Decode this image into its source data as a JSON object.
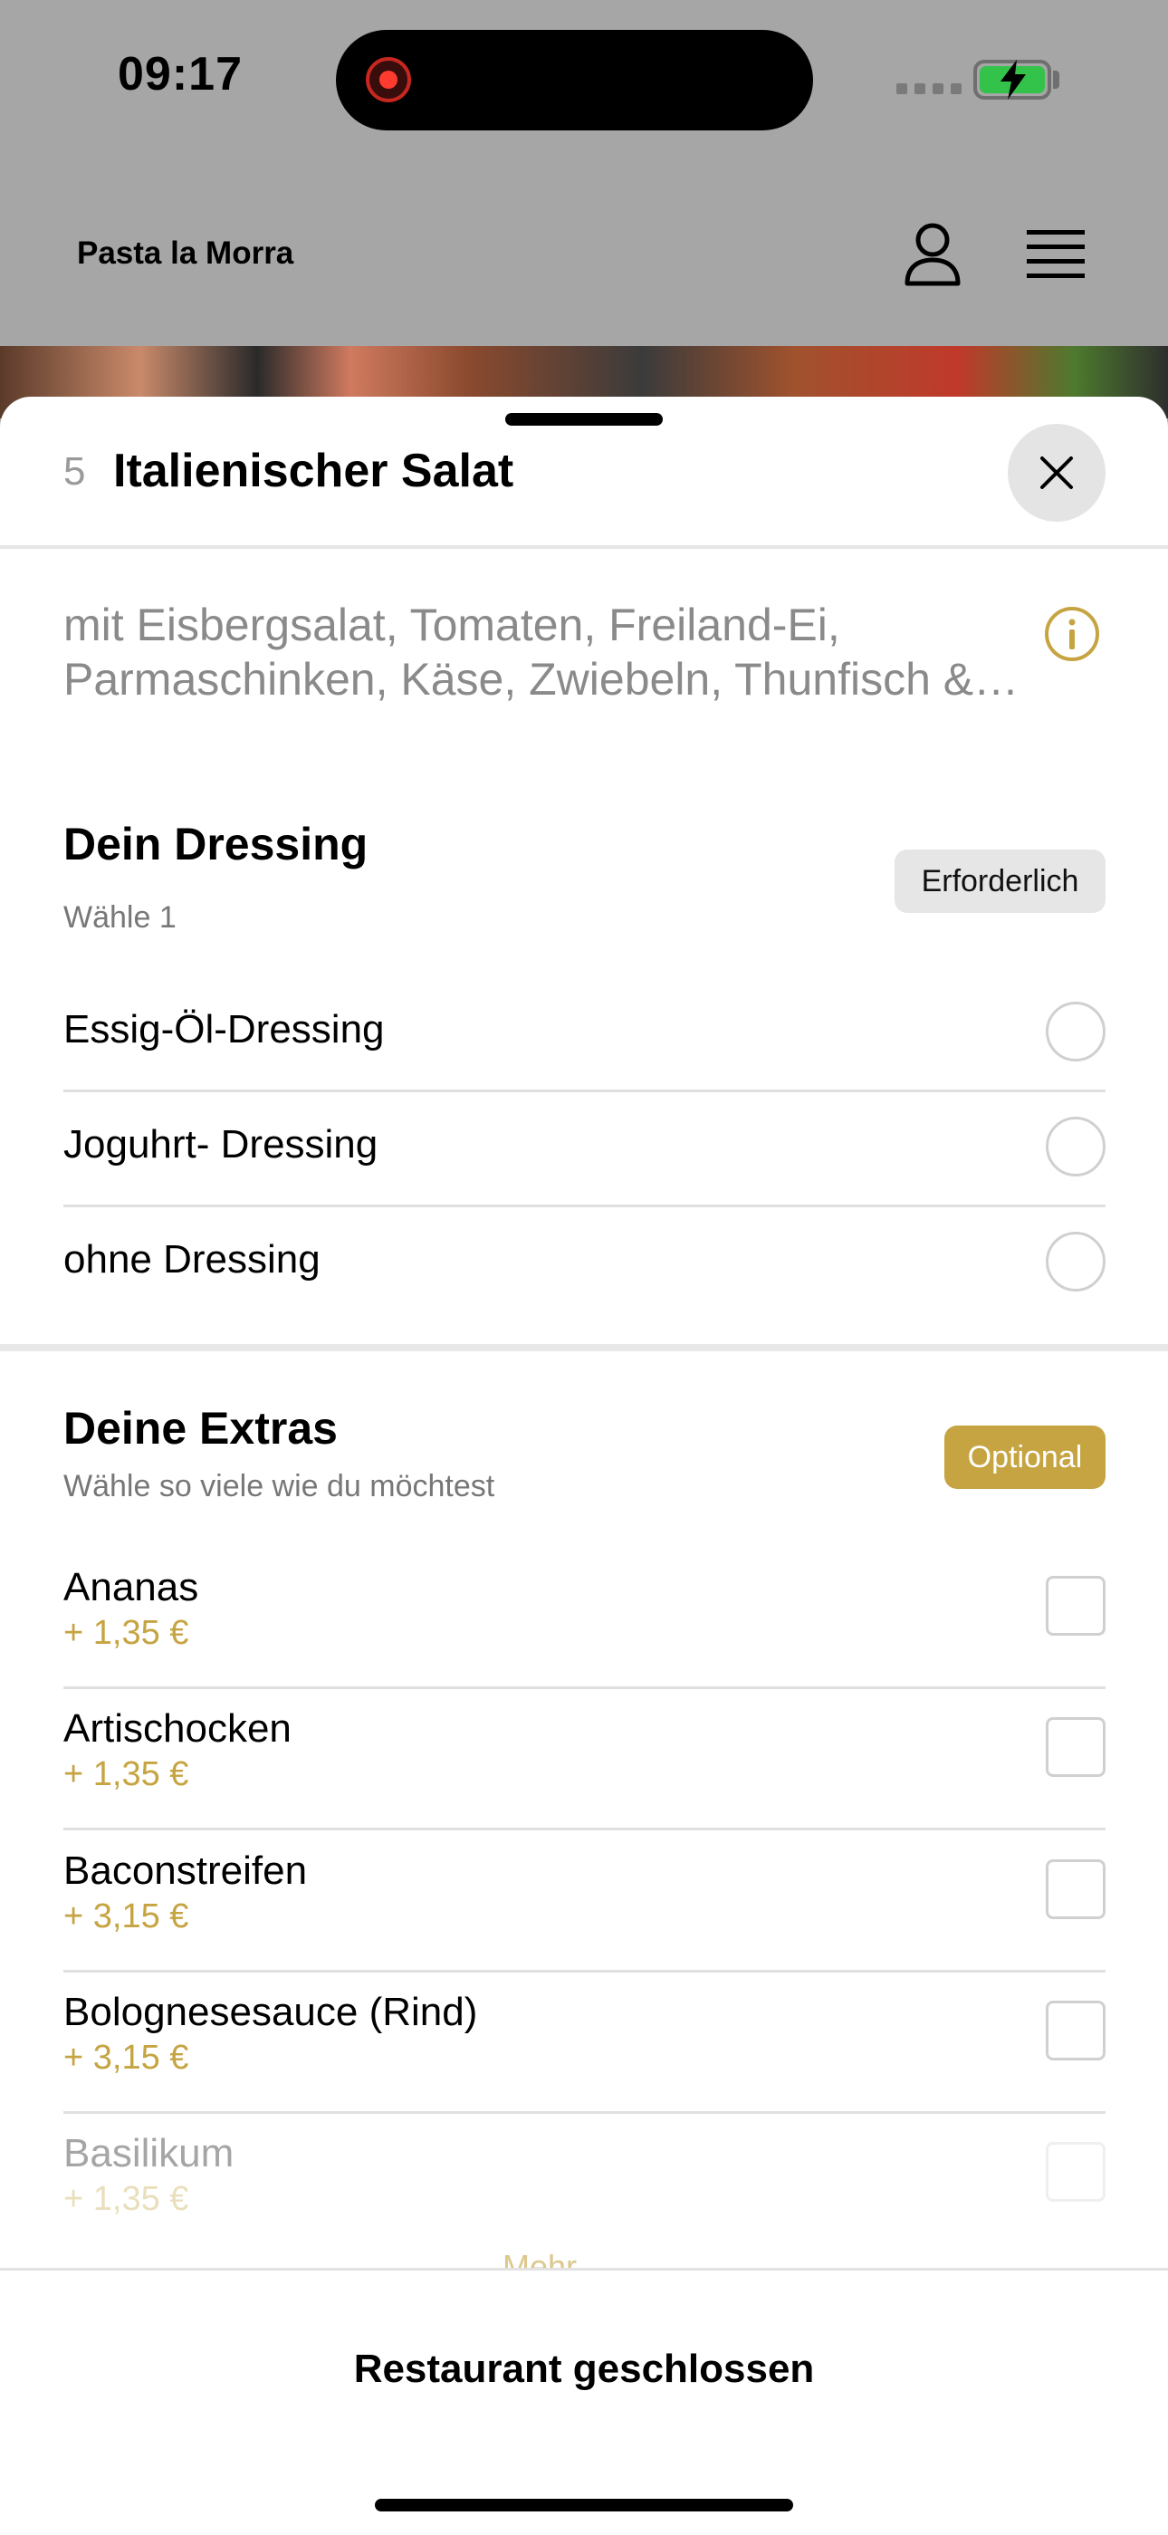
{
  "status_bar": {
    "time": "09:17"
  },
  "header": {
    "brand": "Pasta la Morra"
  },
  "item": {
    "number": "5",
    "title": "Italienischer Salat",
    "description": "mit Eisbergsalat, Tomaten, Freiland-Ei, Parmaschinken, Käse, Zwiebeln, Thunfisch & Oliven"
  },
  "dressing": {
    "title": "Dein Dressing",
    "subtitle": "Wähle 1",
    "badge": "Erforderlich",
    "options": [
      "Essig-Öl-Dressing",
      "Joguhrt- Dressing",
      "ohne Dressing"
    ]
  },
  "extras": {
    "title": "Deine Extras",
    "subtitle": "Wähle so viele wie du möchtest",
    "badge": "Optional",
    "items": [
      {
        "name": "Ananas",
        "price": "+ 1,35 €"
      },
      {
        "name": "Artischocken",
        "price": "+ 1,35 €"
      },
      {
        "name": "Baconstreifen",
        "price": "+ 3,15 €"
      },
      {
        "name": "Bolognesesauce (Rind)",
        "price": "+ 3,15 €"
      },
      {
        "name": "Basilikum",
        "price": "+ 1,35 €"
      }
    ],
    "more_label": "Mehr"
  },
  "footer": {
    "label": "Restaurant geschlossen"
  },
  "colors": {
    "accent": "#c6a442",
    "dim_background": "#a6a6a6"
  }
}
